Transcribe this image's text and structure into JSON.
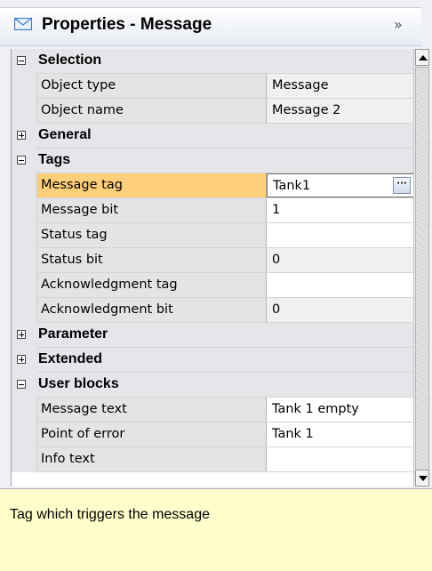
{
  "header": {
    "title": "Properties - Message",
    "icon": "envelope-icon",
    "collapse_glyph": "»"
  },
  "grid": {
    "rows": [
      {
        "kind": "category",
        "expanded": true,
        "label": "Selection"
      },
      {
        "kind": "property",
        "name": "Object type",
        "value": "Message",
        "readonly": true
      },
      {
        "kind": "property",
        "name": "Object name",
        "value": "Message 2",
        "readonly": true
      },
      {
        "kind": "category",
        "expanded": false,
        "label": "General"
      },
      {
        "kind": "category",
        "expanded": true,
        "label": "Tags"
      },
      {
        "kind": "property",
        "name": "Message tag",
        "value": "Tank1",
        "selected": true,
        "ellipsis": "···"
      },
      {
        "kind": "property",
        "name": "Message bit",
        "value": "1"
      },
      {
        "kind": "property",
        "name": "Status tag",
        "value": ""
      },
      {
        "kind": "property",
        "name": "Status bit",
        "value": "0",
        "readonly": true
      },
      {
        "kind": "property",
        "name": "Acknowledgment tag",
        "value": ""
      },
      {
        "kind": "property",
        "name": "Acknowledgment bit",
        "value": "0",
        "readonly": true
      },
      {
        "kind": "category",
        "expanded": false,
        "label": "Parameter"
      },
      {
        "kind": "category",
        "expanded": false,
        "label": "Extended"
      },
      {
        "kind": "category",
        "expanded": true,
        "label": "User blocks"
      },
      {
        "kind": "property",
        "name": "Message text",
        "value": "Tank 1 empty"
      },
      {
        "kind": "property",
        "name": "Point of error",
        "value": "Tank 1"
      },
      {
        "kind": "property",
        "name": "Info text",
        "value": ""
      }
    ]
  },
  "description": {
    "text": "Tag which triggers the message"
  },
  "colors": {
    "selected_name_bg": "#ffcf7a",
    "category_bg": "#e4e6ea",
    "description_bg": "#ffffcc"
  }
}
